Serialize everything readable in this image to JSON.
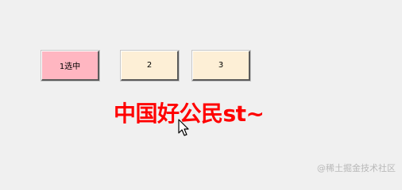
{
  "buttons": [
    {
      "label": "1选中",
      "background": "#ffb6c1"
    },
    {
      "label": "2",
      "background": "#fdefd6"
    },
    {
      "label": "3",
      "background": "#fdefd6"
    }
  ],
  "headline": {
    "text": "中国好公民st~",
    "color": "#ff0000"
  },
  "watermark": {
    "text": "@稀土掘金技术社区"
  },
  "cursor": {
    "icon": "arrow-cursor-icon"
  }
}
